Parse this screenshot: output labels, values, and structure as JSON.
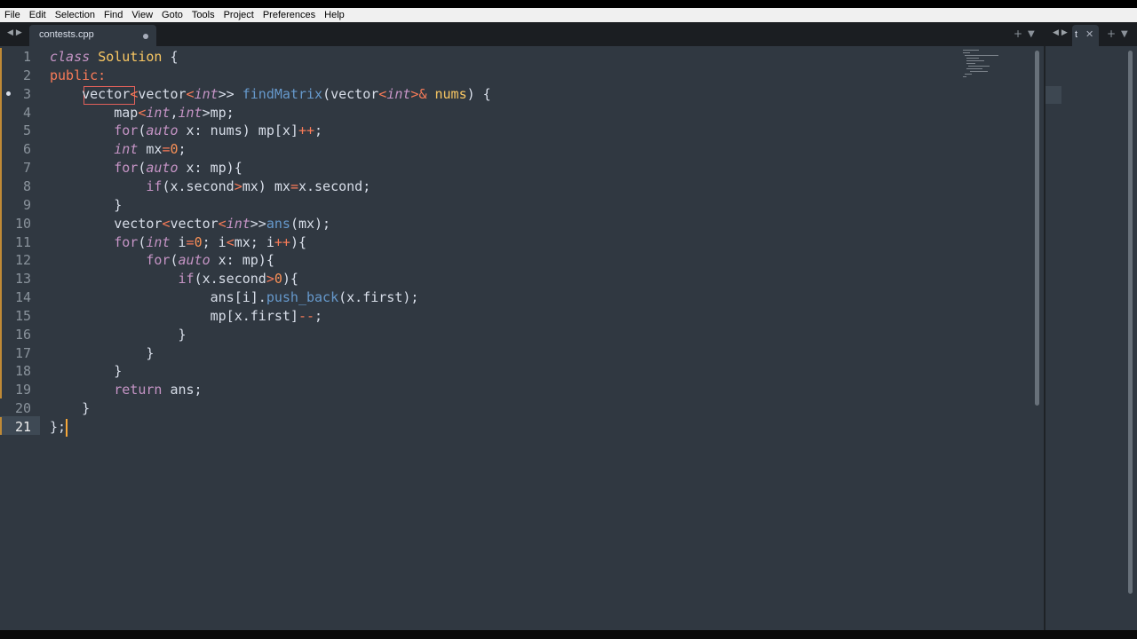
{
  "menu": [
    "File",
    "Edit",
    "Selection",
    "Find",
    "View",
    "Goto",
    "Tools",
    "Project",
    "Preferences",
    "Help"
  ],
  "tabs": {
    "left": {
      "filename": "contests.cpp"
    },
    "right": {
      "label": "t"
    }
  },
  "icons": {
    "nav_back": "triangle-left-icon",
    "nav_forward": "triangle-right-icon",
    "new_tab": "plus-icon",
    "tab_dropdown": "chevron-down-icon",
    "unsaved": "dot-icon",
    "close": "close-icon"
  },
  "editor": {
    "line_numbers": [
      "1",
      "2",
      "3",
      "4",
      "5",
      "6",
      "7",
      "8",
      "9",
      "10",
      "11",
      "12",
      "13",
      "14",
      "15",
      "16",
      "17",
      "18",
      "19",
      "20",
      "21"
    ],
    "active_line": 21,
    "modified_line": 3,
    "lines": [
      [
        {
          "t": "class",
          "c": "kw"
        },
        {
          "t": " ",
          "c": "plain"
        },
        {
          "t": "Solution",
          "c": "cls"
        },
        {
          "t": " {",
          "c": "plain"
        }
      ],
      [
        {
          "t": "public:",
          "c": "op"
        }
      ],
      [
        {
          "t": "    ",
          "c": "plain"
        },
        {
          "t": "vector",
          "c": "plain"
        },
        {
          "t": "<",
          "c": "op"
        },
        {
          "t": "vector",
          "c": "plain"
        },
        {
          "t": "<",
          "c": "op"
        },
        {
          "t": "int",
          "c": "type"
        },
        {
          "t": ">> ",
          "c": "plain"
        },
        {
          "t": "findMatrix",
          "c": "fn"
        },
        {
          "t": "(vector",
          "c": "plain"
        },
        {
          "t": "<",
          "c": "op"
        },
        {
          "t": "int",
          "c": "type"
        },
        {
          "t": ">",
          "c": "op"
        },
        {
          "t": "& ",
          "c": "op"
        },
        {
          "t": "nums",
          "c": "cls"
        },
        {
          "t": ") {",
          "c": "plain"
        }
      ],
      [
        {
          "t": "        map",
          "c": "plain"
        },
        {
          "t": "<",
          "c": "op"
        },
        {
          "t": "int",
          "c": "type"
        },
        {
          "t": ",",
          "c": "plain"
        },
        {
          "t": "int",
          "c": "type"
        },
        {
          "t": ">mp;",
          "c": "plain"
        }
      ],
      [
        {
          "t": "        ",
          "c": "plain"
        },
        {
          "t": "for",
          "c": "kw-plain"
        },
        {
          "t": "(",
          "c": "plain"
        },
        {
          "t": "auto",
          "c": "type"
        },
        {
          "t": " x: nums) mp[x]",
          "c": "plain"
        },
        {
          "t": "++",
          "c": "op"
        },
        {
          "t": ";",
          "c": "plain"
        }
      ],
      [
        {
          "t": "        ",
          "c": "plain"
        },
        {
          "t": "int",
          "c": "type"
        },
        {
          "t": " mx",
          "c": "plain"
        },
        {
          "t": "=",
          "c": "op"
        },
        {
          "t": "0",
          "c": "num"
        },
        {
          "t": ";",
          "c": "plain"
        }
      ],
      [
        {
          "t": "        ",
          "c": "plain"
        },
        {
          "t": "for",
          "c": "kw-plain"
        },
        {
          "t": "(",
          "c": "plain"
        },
        {
          "t": "auto",
          "c": "type"
        },
        {
          "t": " x: mp){",
          "c": "plain"
        }
      ],
      [
        {
          "t": "            ",
          "c": "plain"
        },
        {
          "t": "if",
          "c": "kw-plain"
        },
        {
          "t": "(x.second",
          "c": "plain"
        },
        {
          "t": ">",
          "c": "op"
        },
        {
          "t": "mx) mx",
          "c": "plain"
        },
        {
          "t": "=",
          "c": "op"
        },
        {
          "t": "x.second;",
          "c": "plain"
        }
      ],
      [
        {
          "t": "        }",
          "c": "plain"
        }
      ],
      [
        {
          "t": "        vector",
          "c": "plain"
        },
        {
          "t": "<",
          "c": "op"
        },
        {
          "t": "vector",
          "c": "plain"
        },
        {
          "t": "<",
          "c": "op"
        },
        {
          "t": "int",
          "c": "type"
        },
        {
          "t": ">>",
          "c": "plain"
        },
        {
          "t": "ans",
          "c": "fn"
        },
        {
          "t": "(mx);",
          "c": "plain"
        }
      ],
      [
        {
          "t": "        ",
          "c": "plain"
        },
        {
          "t": "for",
          "c": "kw-plain"
        },
        {
          "t": "(",
          "c": "plain"
        },
        {
          "t": "int",
          "c": "type"
        },
        {
          "t": " i",
          "c": "plain"
        },
        {
          "t": "=",
          "c": "op"
        },
        {
          "t": "0",
          "c": "num"
        },
        {
          "t": "; i",
          "c": "plain"
        },
        {
          "t": "<",
          "c": "op"
        },
        {
          "t": "mx; i",
          "c": "plain"
        },
        {
          "t": "++",
          "c": "op"
        },
        {
          "t": "){",
          "c": "plain"
        }
      ],
      [
        {
          "t": "            ",
          "c": "plain"
        },
        {
          "t": "for",
          "c": "kw-plain"
        },
        {
          "t": "(",
          "c": "plain"
        },
        {
          "t": "auto",
          "c": "type"
        },
        {
          "t": " x: mp){",
          "c": "plain"
        }
      ],
      [
        {
          "t": "                ",
          "c": "plain"
        },
        {
          "t": "if",
          "c": "kw-plain"
        },
        {
          "t": "(x.second",
          "c": "plain"
        },
        {
          "t": ">",
          "c": "op"
        },
        {
          "t": "0",
          "c": "num"
        },
        {
          "t": "){",
          "c": "plain"
        }
      ],
      [
        {
          "t": "                    ans[i].",
          "c": "plain"
        },
        {
          "t": "push_back",
          "c": "fn"
        },
        {
          "t": "(x.first);",
          "c": "plain"
        }
      ],
      [
        {
          "t": "                    mp[x.first]",
          "c": "plain"
        },
        {
          "t": "--",
          "c": "op"
        },
        {
          "t": ";",
          "c": "plain"
        }
      ],
      [
        {
          "t": "                }",
          "c": "plain"
        }
      ],
      [
        {
          "t": "            }",
          "c": "plain"
        }
      ],
      [
        {
          "t": "        }",
          "c": "plain"
        }
      ],
      [
        {
          "t": "        ",
          "c": "plain"
        },
        {
          "t": "return",
          "c": "kw-plain"
        },
        {
          "t": " ans;",
          "c": "plain"
        }
      ],
      [
        {
          "t": "    }",
          "c": "plain"
        }
      ],
      [
        {
          "t": "};",
          "c": "plain"
        }
      ]
    ]
  }
}
